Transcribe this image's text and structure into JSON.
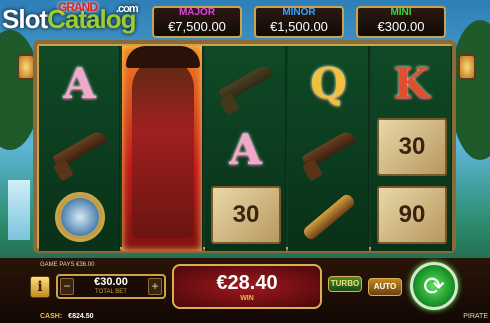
{
  "logo": {
    "main": "Slot",
    "accent": "Catalog",
    "com": ".com"
  },
  "jackpots": {
    "grand_label": "GRAND",
    "major": {
      "label": "MAJOR",
      "value": "€7,500.00"
    },
    "minor": {
      "label": "MINOR",
      "value": "€1,500.00"
    },
    "mini": {
      "label": "MINI",
      "value": "€300.00"
    }
  },
  "reels": [
    {
      "symbols": [
        "A",
        "pistol-icon",
        "compass-icon"
      ]
    },
    {
      "symbols": [
        "wild-pirate"
      ]
    },
    {
      "symbols": [
        "pistol-icon",
        "A",
        "30"
      ]
    },
    {
      "symbols": [
        "Q",
        "pistol-icon",
        "spyglass-icon"
      ]
    },
    {
      "symbols": [
        "K",
        "30",
        "90"
      ]
    }
  ],
  "bottom": {
    "game_pays": "GAME PAYS €36.00",
    "info": "i",
    "bet": {
      "amount": "€30.00",
      "label": "TOTAL BET",
      "minus": "−",
      "plus": "+"
    },
    "win": {
      "amount": "€28.40",
      "label": "WIN"
    },
    "turbo": "TURBO",
    "auto": "AUTO",
    "spin": "⟳",
    "cash_label": "CASH:",
    "cash_value": "€824.50",
    "game_name": "PIRATE"
  }
}
